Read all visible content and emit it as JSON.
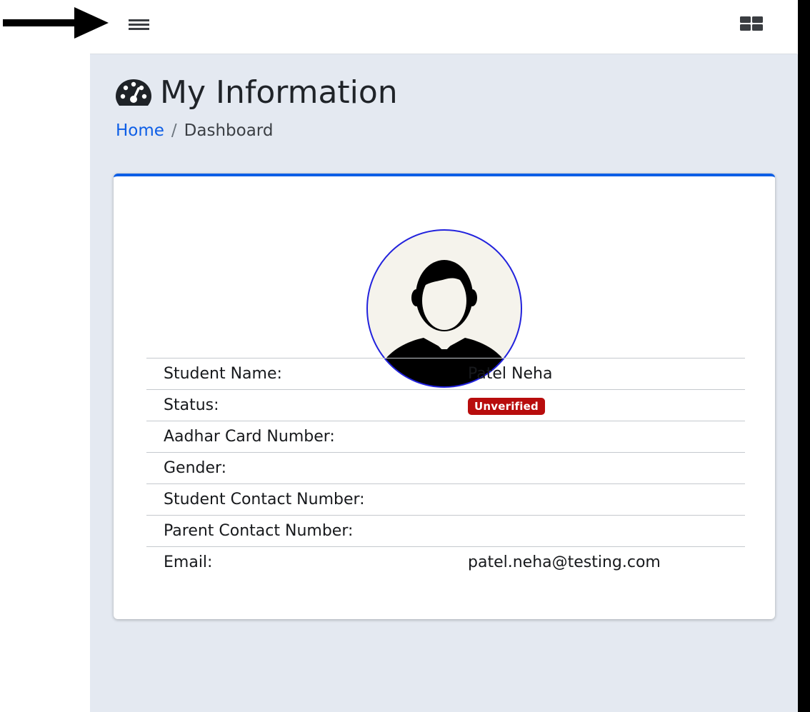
{
  "header": {
    "menu_icon": "hamburger-menu-icon",
    "grid_icon": "grid-apps-icon",
    "pointer_icon": "arrow-right-icon"
  },
  "page": {
    "title": "My Information",
    "title_icon": "tachometer-dashboard-icon"
  },
  "breadcrumb": {
    "home": "Home",
    "separator": "/",
    "current": "Dashboard"
  },
  "profile": {
    "avatar_icon": "user-avatar-icon",
    "rows": [
      {
        "label": "Student Name:",
        "value": "Patel Neha"
      },
      {
        "label": "Status:",
        "value": "Unverified",
        "badge": true
      },
      {
        "label": "Aadhar Card Number:",
        "value": ""
      },
      {
        "label": "Gender:",
        "value": ""
      },
      {
        "label": "Student Contact Number:",
        "value": ""
      },
      {
        "label": "Parent Contact Number:",
        "value": ""
      },
      {
        "label": "Email:",
        "value": "patel.neha@testing.com"
      }
    ]
  },
  "colors": {
    "accent": "#0d5ee6",
    "badge_danger": "#b80d0d",
    "content_bg": "#e4e9f1"
  }
}
